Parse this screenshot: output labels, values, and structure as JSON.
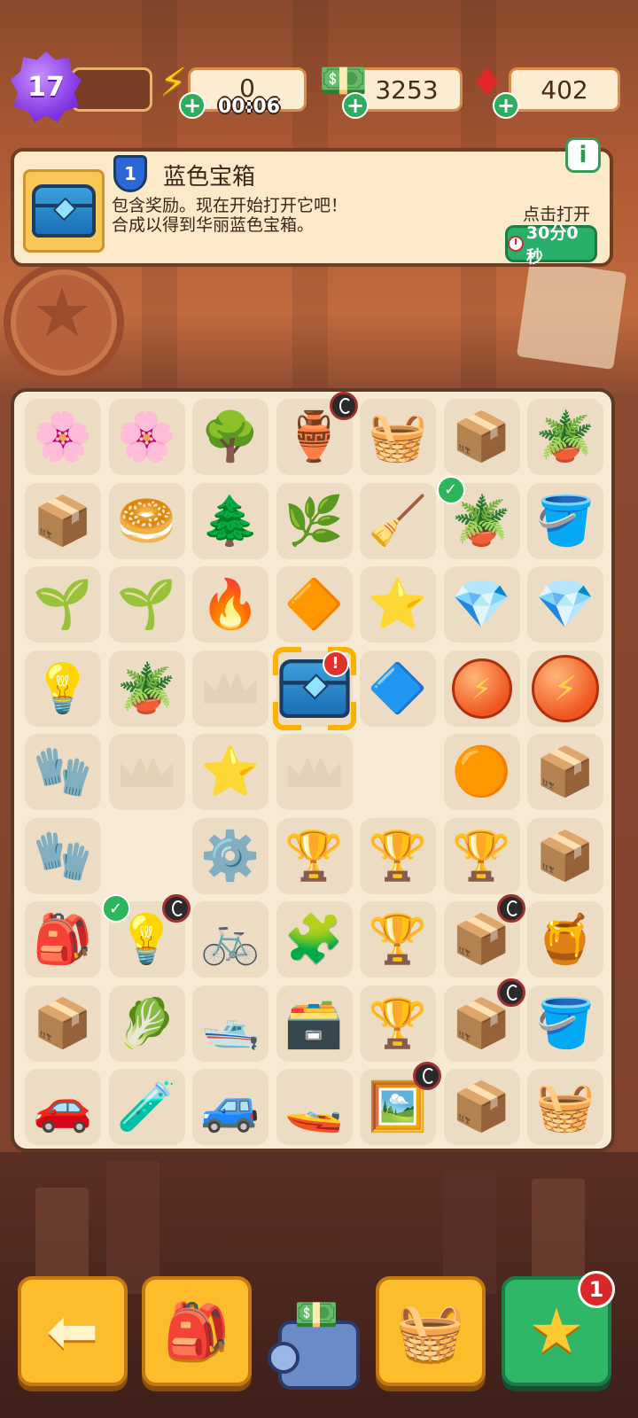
{
  "hud": {
    "level": "17",
    "energy": {
      "value": "0",
      "timer": "00:06",
      "icon": "lightning-bolt-icon"
    },
    "cash": {
      "value": "3253",
      "icon": "cash-stack-icon"
    },
    "gems": {
      "value": "402",
      "icon": "ruby-gem-icon"
    }
  },
  "info_panel": {
    "level_badge": "1",
    "title": "蓝色宝箱",
    "description": "包含奖励。现在开始打开它吧！\n合成以得到华丽蓝色宝箱。",
    "info_button": "i",
    "tap_to_open": "点击打开",
    "open_timer": "30分0秒"
  },
  "board": {
    "cols": 7,
    "rows": 9,
    "items": [
      [
        "🌸",
        "🌸",
        "🌳",
        "🏺",
        "🧺",
        "📦",
        "🪴"
      ],
      [
        "📦",
        "🥯",
        "🌲",
        "🌿",
        "🧹",
        "🪴",
        "🪣"
      ],
      [
        "🌱",
        "🌱",
        "🔥",
        "🔶",
        "⭐",
        "💎",
        "💎"
      ],
      [
        "💡",
        "🪴",
        "",
        "chest",
        "🔷",
        "bolt",
        "bolt"
      ],
      [
        "🧤",
        "",
        "⭐",
        "",
        "",
        "🟠",
        "📦"
      ],
      [
        "🧤",
        "",
        "⚙️",
        "🏆",
        "🏆",
        "🏆",
        "📦"
      ],
      [
        "🎒",
        "💡",
        "🚲",
        "🧩",
        "🏆",
        "📦",
        "🍯"
      ],
      [
        "📦",
        "🥬",
        "🛥️",
        "🗃️",
        "🏆",
        "📦",
        "🪣"
      ],
      [
        "🚗",
        "🧪",
        "🚙",
        "🚤",
        "🖼️",
        "📦",
        "🧺"
      ]
    ]
  },
  "bottom_bar": {
    "back_icon": "arrow-left-icon",
    "bag_icon": "backpack-icon",
    "shop_icon": "basket-icon",
    "star_icon": "star-icon",
    "star_notification": "1"
  }
}
